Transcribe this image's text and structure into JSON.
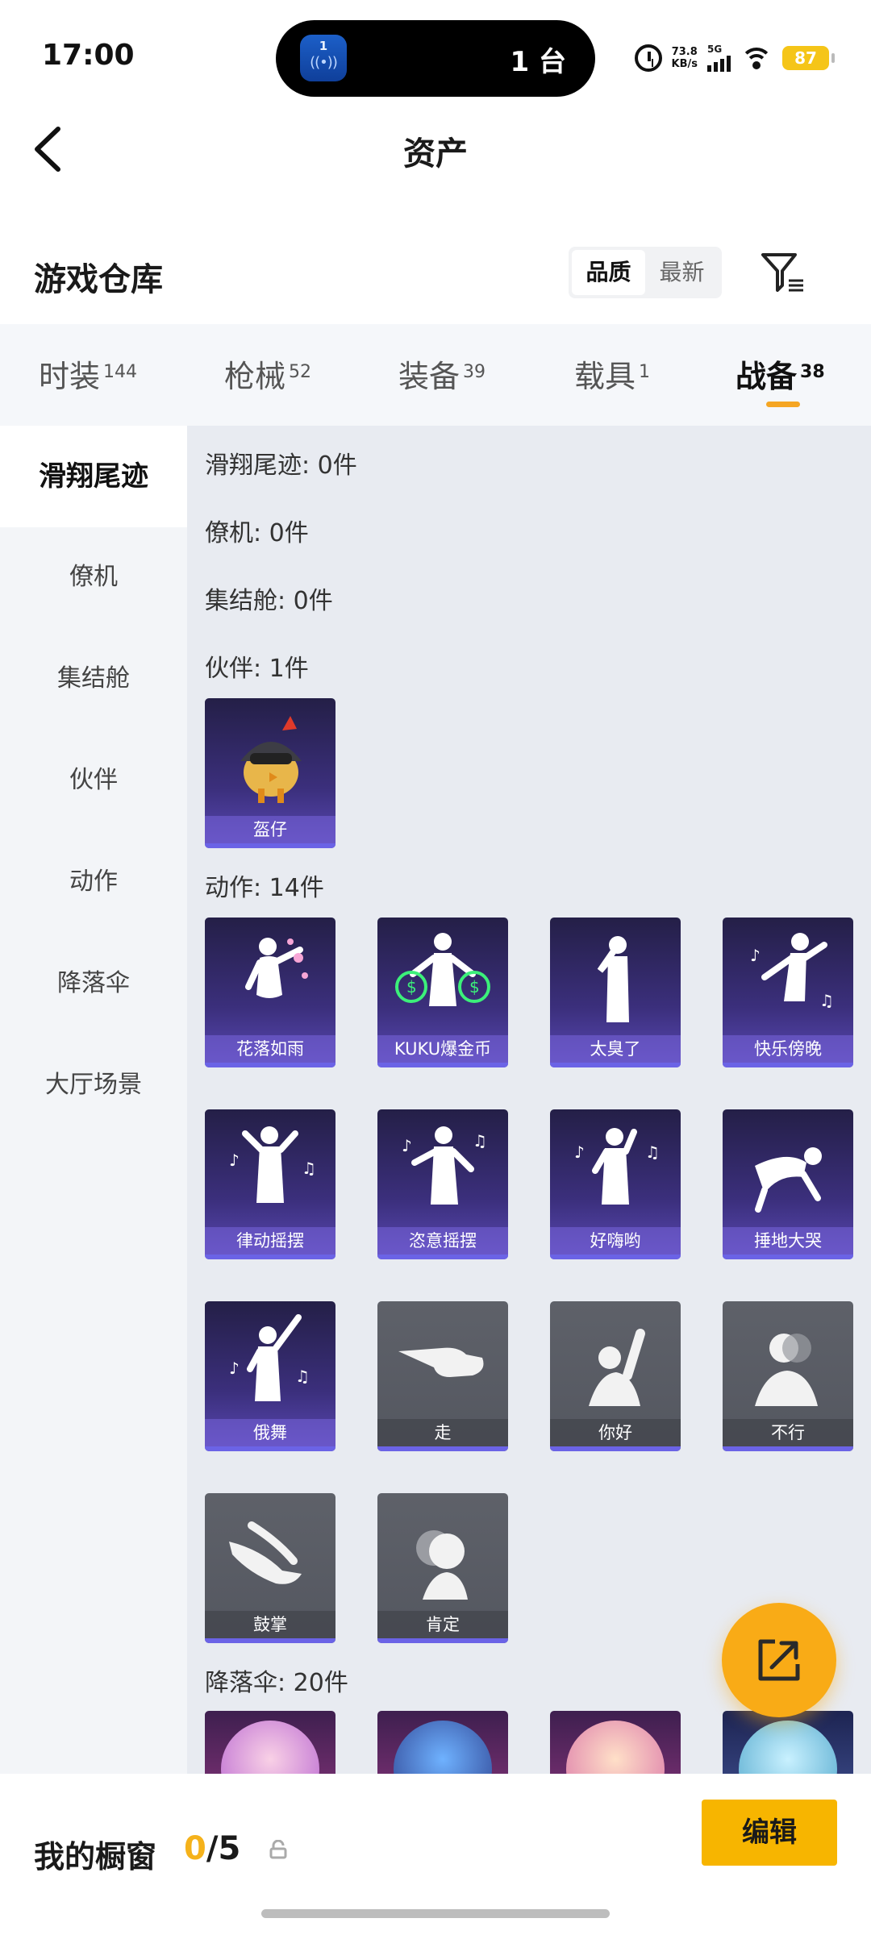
{
  "status_bar": {
    "time": "17:00",
    "island_badge": "1",
    "island_text": "1 台",
    "net_speed_value": "73.8",
    "net_speed_unit": "KB/s",
    "signal_label": "5G",
    "battery": "87"
  },
  "header": {
    "title": "资产"
  },
  "warehouse": {
    "title": "游戏仓库",
    "sort_options": [
      "品质",
      "最新"
    ],
    "active_sort": "品质"
  },
  "tabs": [
    {
      "label": "时装",
      "count": "144"
    },
    {
      "label": "枪械",
      "count": "52"
    },
    {
      "label": "装备",
      "count": "39"
    },
    {
      "label": "载具",
      "count": "1"
    },
    {
      "label": "战备",
      "count": "38"
    }
  ],
  "active_tab": "战备",
  "sidebar": {
    "items": [
      "滑翔尾迹",
      "僚机",
      "集结舱",
      "伙伴",
      "动作",
      "降落伞",
      "大厅场景"
    ],
    "active": "滑翔尾迹"
  },
  "sections": {
    "glide_trail": "滑翔尾迹: 0件",
    "wingman": "僚机: 0件",
    "assembly_pod": "集结舱: 0件",
    "partner": "伙伴: 1件",
    "emotes": "动作: 14件",
    "parachute": "降落伞: 20件"
  },
  "partner_items": [
    {
      "name": "盔仔"
    }
  ],
  "emote_items": [
    {
      "name": "花落如雨",
      "style": "purple"
    },
    {
      "name": "KUKU爆金币",
      "style": "purple"
    },
    {
      "name": "太臭了",
      "style": "purple"
    },
    {
      "name": "快乐傍晚",
      "style": "purple"
    },
    {
      "name": "律动摇摆",
      "style": "purple"
    },
    {
      "name": "恣意摇摆",
      "style": "purple"
    },
    {
      "name": "好嗨哟",
      "style": "purple"
    },
    {
      "name": "捶地大哭",
      "style": "purple"
    },
    {
      "name": "俄舞",
      "style": "purple"
    },
    {
      "name": "走",
      "style": "gray"
    },
    {
      "name": "你好",
      "style": "gray"
    },
    {
      "name": "不行",
      "style": "gray"
    },
    {
      "name": "鼓掌",
      "style": "gray"
    },
    {
      "name": "肯定",
      "style": "gray"
    }
  ],
  "bottom_bar": {
    "showcase_label": "我的橱窗",
    "showcase_current": "0",
    "showcase_total": "/5",
    "edit_label": "编辑"
  }
}
